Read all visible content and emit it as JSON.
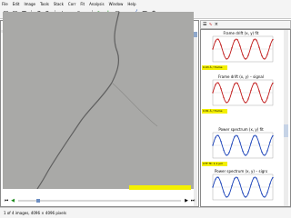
{
  "menubar": {
    "items": [
      "File",
      "Edit",
      "Image",
      "Tools",
      "Stack",
      "Corr",
      "Fit",
      "Analysis",
      "Window",
      "Help"
    ]
  },
  "toolbar": {
    "zoom_label": "Zoom",
    "icons": [
      "open-icon",
      "save-icon",
      "print-icon",
      "undo-icon",
      "redo-icon",
      "zoom-in-icon",
      "zoom-out-icon",
      "cursor-icon",
      "crosshair-icon",
      "region-icon",
      "measure-icon",
      "line-icon",
      "grid-icon",
      "gear-icon"
    ]
  },
  "viewer": {
    "title": "Micrograph — Cryo image 1.tif",
    "colors": {
      "image": "#a9a9a7",
      "scale_bar": "#f3ef00"
    }
  },
  "plots": [
    {
      "caption": "Frame drift (x, y) fit",
      "color": "#c01818",
      "label": "0.93 Å / frame"
    },
    {
      "caption": "Frame drift (x, y) – signal",
      "color": "#c01818",
      "label": "0.81 Å / frame"
    },
    {
      "caption": "Power spectrum (x, y) fit",
      "color": "#1840b8",
      "label": "CTF fit: 1.1 μm"
    },
    {
      "caption": "Power spectrum (x, y) – signal",
      "color": "#1840b8",
      "label": "CTF fit: 1.1 μm"
    }
  ],
  "status": {
    "text": "1 of 4 images, 4096 × 4096 pixels"
  }
}
